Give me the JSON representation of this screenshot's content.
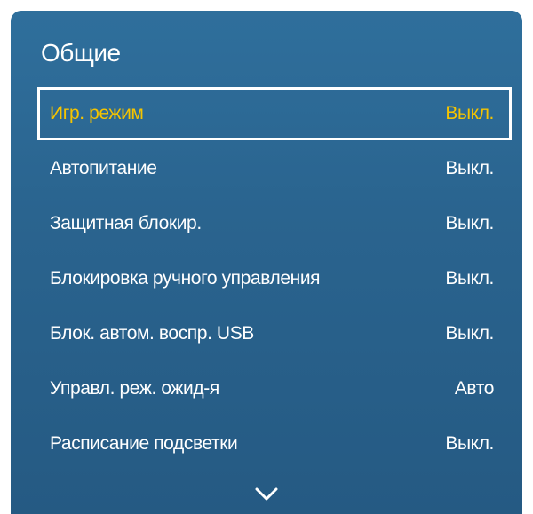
{
  "menu": {
    "title": "Общие",
    "items": [
      {
        "label": "Игр. режим",
        "value": "Выкл.",
        "selected": true
      },
      {
        "label": "Автопитание",
        "value": "Выкл."
      },
      {
        "label": "Защитная блокир.",
        "value": "Выкл."
      },
      {
        "label": "Блокировка ручного управления",
        "value": "Выкл."
      },
      {
        "label": "Блок. автом. воспр. USB",
        "value": "Выкл."
      },
      {
        "label": "Управл. реж. ожид-я",
        "value": "Авто"
      },
      {
        "label": "Расписание подсветки",
        "value": "Выкл."
      }
    ],
    "scroll_icon": "chevron-down-icon"
  },
  "colors": {
    "panel_top": "#2f6f9c",
    "panel_bottom": "#255a83",
    "text": "#ffffff",
    "selected_text": "#f5c400",
    "selected_border": "#ffffff"
  }
}
